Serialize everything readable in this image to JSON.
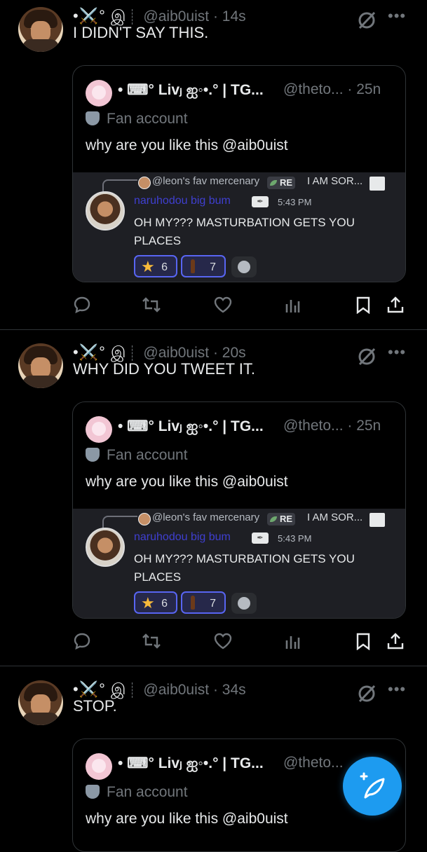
{
  "tweets": [
    {
      "display_emoji": "•⚔️° இ",
      "handle_time": "@aib0uist · 14s",
      "text": "I DIDN'T SAY THIS."
    },
    {
      "display_emoji": "•⚔️° இ",
      "handle_time": "@aib0uist · 20s",
      "text": "WHY DID YOU TWEET IT."
    },
    {
      "display_emoji": "•⚔️° இ",
      "handle_time": "@aib0uist · 34s",
      "text": "STOP."
    }
  ],
  "quote": {
    "name": "• ⌨° Livⱼ ஐ◦•.° | TG...",
    "handle_time": "@theto... · 25n",
    "handle_time_truncated": "@theto...",
    "badge": "Fan account",
    "text": "why are you like this @aib0uist"
  },
  "discord": {
    "reply_author": "@leon's fav mercenary",
    "reply_tag": "RE",
    "reply_text": "I AM SOR...",
    "author": "naruhodou big bum",
    "time": "5:43 PM",
    "message": "OH MY??? MASTURBATION GETS YOU PLACES",
    "reactions": [
      {
        "emoji": "star",
        "count": "6"
      },
      {
        "emoji": "bottle",
        "count": "7"
      }
    ]
  },
  "colors": {
    "accent": "#1d9bf0",
    "discord_name": "#3f3fd0",
    "reaction_border": "#5865f2"
  },
  "icons": [
    "reply-icon",
    "retweet-icon",
    "like-icon",
    "views-icon",
    "bookmark-icon",
    "share-icon",
    "grok-icon",
    "more-icon",
    "compose-icon"
  ]
}
